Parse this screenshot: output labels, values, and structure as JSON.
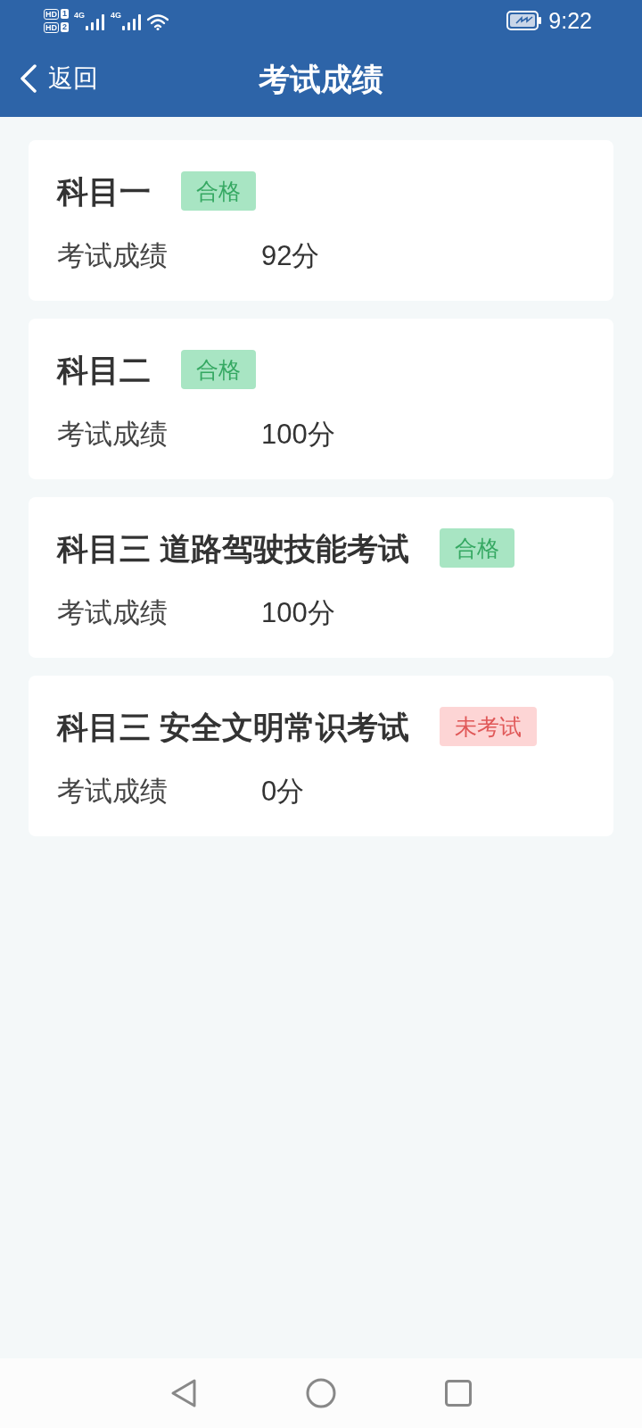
{
  "status_bar": {
    "hd_badges": [
      {
        "text": "HD",
        "slot": "1"
      },
      {
        "text": "HD",
        "slot": "2"
      }
    ],
    "signals": [
      {
        "network": "4G"
      },
      {
        "network": "4G"
      }
    ],
    "time": "9:22"
  },
  "header": {
    "back_label": "返回",
    "title": "考试成绩"
  },
  "results": [
    {
      "subject": "科目一",
      "badge": {
        "text": "合格",
        "kind": "pass"
      },
      "score_label": "考试成绩",
      "score": "92分"
    },
    {
      "subject": "科目二",
      "badge": {
        "text": "合格",
        "kind": "pass"
      },
      "score_label": "考试成绩",
      "score": "100分"
    },
    {
      "subject": "科目三 道路驾驶技能考试",
      "badge": {
        "text": "合格",
        "kind": "pass"
      },
      "score_label": "考试成绩",
      "score": "100分"
    },
    {
      "subject": "科目三 安全文明常识考试",
      "badge": {
        "text": "未考试",
        "kind": "not_taken"
      },
      "score_label": "考试成绩",
      "score": "0分"
    }
  ]
}
